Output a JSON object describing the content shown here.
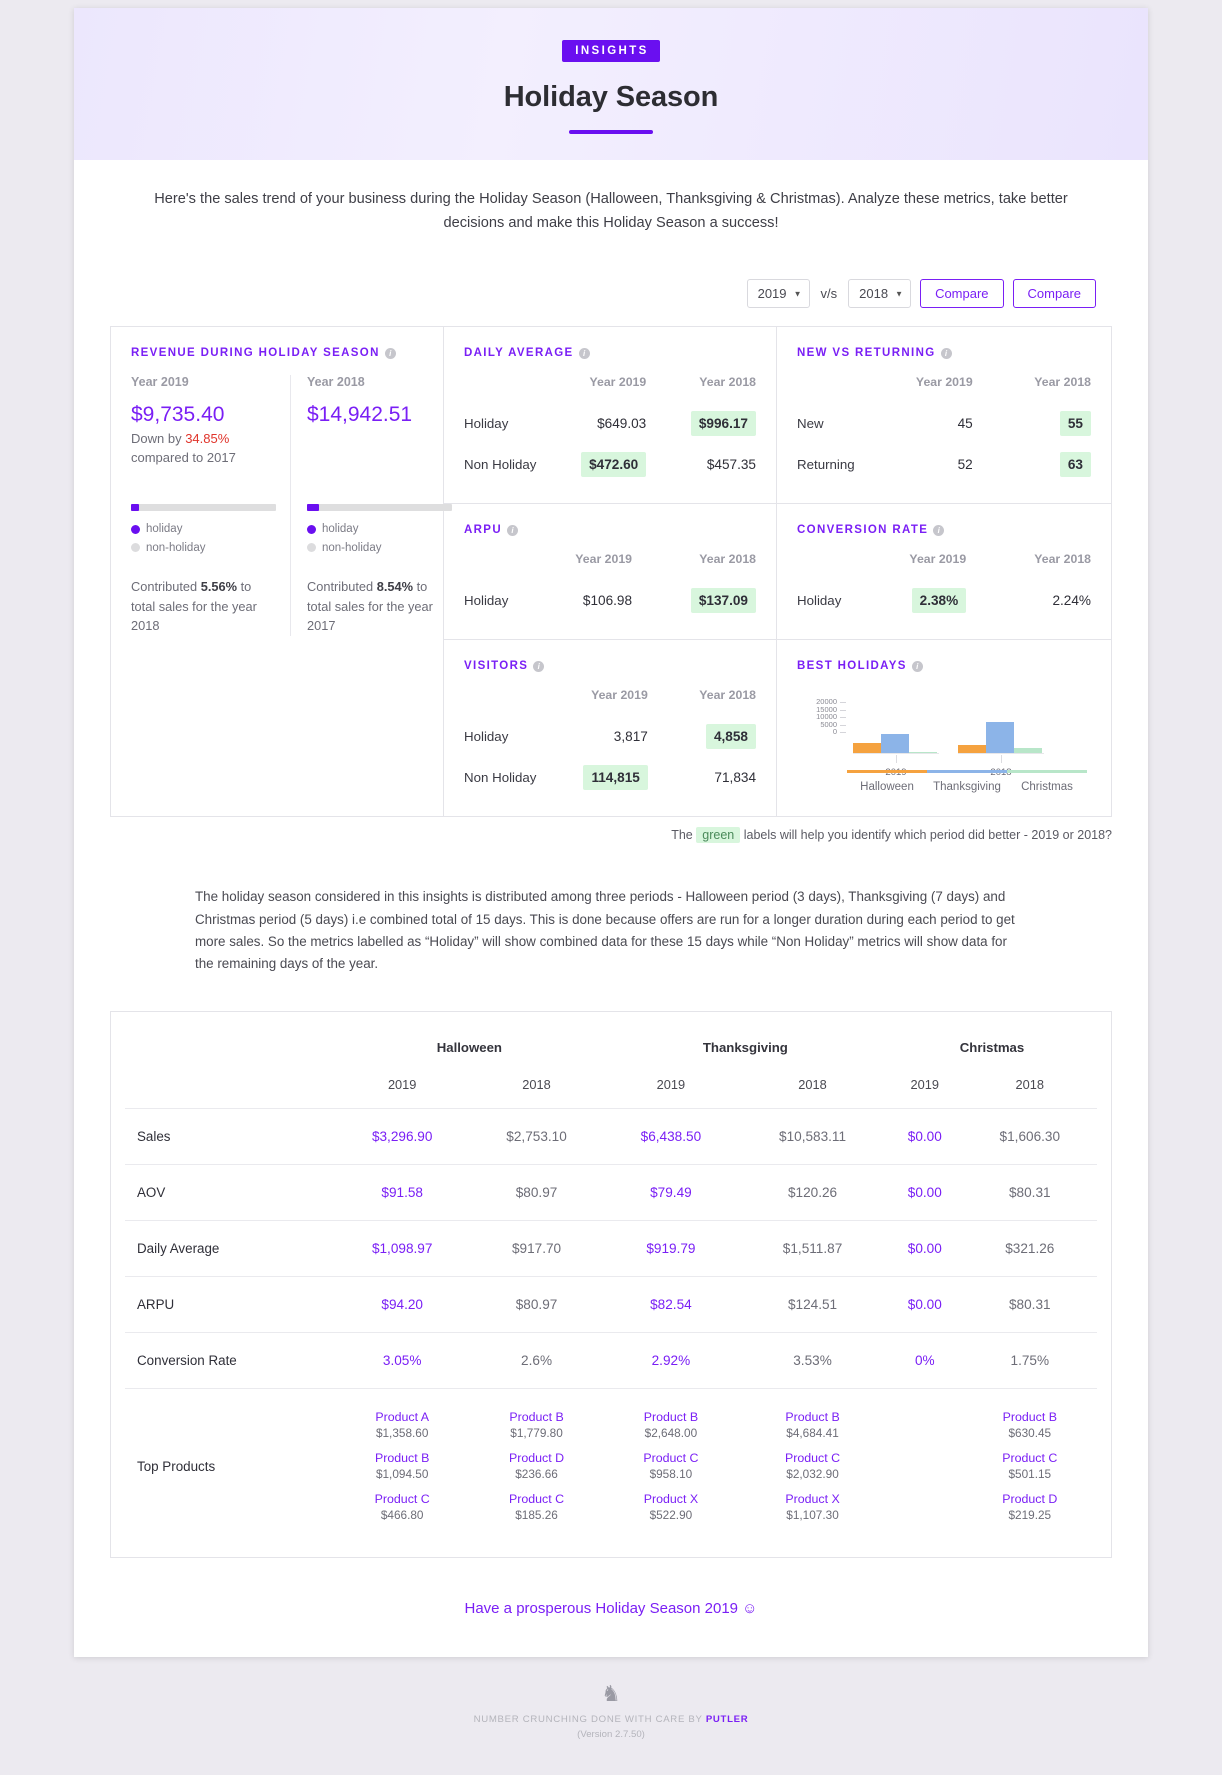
{
  "header": {
    "badge": "INSIGHTS",
    "title": "Holiday Season"
  },
  "intro": "Here's the sales trend of your business during the Holiday Season (Halloween, Thanksgiving & Christmas). Analyze these metrics, take better decisions and make this Holiday Season a success!",
  "controls": {
    "year_primary": "2019",
    "vs_label": "v/s",
    "year_secondary": "2018",
    "compare_label": "Compare",
    "compare_label_2": "Compare",
    "caret": "▼"
  },
  "revenue": {
    "title": "REVENUE DURING HOLIDAY SEASON",
    "left": {
      "year_label": "Year 2019",
      "amount": "$9,735.40",
      "trend_prefix": "Down by",
      "trend_value": "34.85%",
      "trend_suffix": "compared to 2017",
      "bar_percent": 5.56,
      "legend_holiday": "holiday",
      "legend_nonholiday": "non-holiday",
      "contrib_prefix": "Contributed",
      "contrib_value": "5.56%",
      "contrib_suffix": "to total sales for the year 2018"
    },
    "right": {
      "year_label": "Year 2018",
      "amount": "$14,942.51",
      "bar_percent": 8.54,
      "legend_holiday": "holiday",
      "legend_nonholiday": "non-holiday",
      "contrib_prefix": "Contributed",
      "contrib_value": "8.54%",
      "contrib_suffix": "to total sales for the year 2017"
    }
  },
  "daily_average": {
    "title": "DAILY AVERAGE",
    "col_2019": "Year 2019",
    "col_2018": "Year 2018",
    "rows": [
      {
        "label": "Holiday",
        "v2019": "$649.03",
        "v2018": "$996.17",
        "hl": "2018"
      },
      {
        "label": "Non Holiday",
        "v2019": "$472.60",
        "v2018": "$457.35",
        "hl": "2019"
      }
    ]
  },
  "arpu": {
    "title": "ARPU",
    "col_2019": "Year 2019",
    "col_2018": "Year 2018",
    "rows": [
      {
        "label": "Holiday",
        "v2019": "$106.98",
        "v2018": "$137.09",
        "hl": "2018"
      }
    ]
  },
  "visitors": {
    "title": "VISITORS",
    "col_2019": "Year 2019",
    "col_2018": "Year 2018",
    "rows": [
      {
        "label": "Holiday",
        "v2019": "3,817",
        "v2018": "4,858",
        "hl": "2018"
      },
      {
        "label": "Non Holiday",
        "v2019": "114,815",
        "v2018": "71,834",
        "hl": "2019"
      }
    ]
  },
  "new_vs_returning": {
    "title": "NEW VS RETURNING",
    "col_2019": "Year 2019",
    "col_2018": "Year 2018",
    "rows": [
      {
        "label": "New",
        "v2019": "45",
        "v2018": "55",
        "hl": "2018"
      },
      {
        "label": "Returning",
        "v2019": "52",
        "v2018": "63",
        "hl": "2018"
      }
    ]
  },
  "conversion_rate": {
    "title": "CONVERSION RATE",
    "col_2019": "Year 2019",
    "col_2018": "Year 2018",
    "rows": [
      {
        "label": "Holiday",
        "v2019": "2.38%",
        "v2018": "2.24%",
        "hl": "2019"
      }
    ]
  },
  "best_holidays": {
    "title": "BEST HOLIDAYS",
    "group_labels": [
      "2019",
      "2018"
    ],
    "x_labels": [
      "Halloween",
      "Thanksgiving",
      "Christmas"
    ],
    "colors": {
      "halloween": "#f5a23f",
      "thanksgiving": "#8cb4e8",
      "christmas": "#b8e6c9"
    }
  },
  "chart_data": {
    "type": "bar",
    "title": "Best Holidays",
    "xlabel": "",
    "ylabel": "",
    "ylim": [
      0,
      20000
    ],
    "yticks": [
      0,
      5000,
      10000,
      15000,
      20000
    ],
    "ytick_labels": [
      "0",
      "5000",
      "10000",
      "15000",
      "20000"
    ],
    "grid": false,
    "legend_position": "bottom",
    "categories": [
      "2019",
      "2018"
    ],
    "series": [
      {
        "name": "Halloween",
        "color": "#f5a23f",
        "values": [
          3296.9,
          2753.1
        ]
      },
      {
        "name": "Thanksgiving",
        "color": "#8cb4e8",
        "values": [
          6438.5,
          10583.11
        ]
      },
      {
        "name": "Christmas",
        "color": "#b8e6c9",
        "values": [
          0.0,
          1606.3
        ]
      }
    ]
  },
  "green_note": {
    "prefix": "The",
    "green_word": "green",
    "suffix": "labels will help you identify which period did better - 2019 or 2018?"
  },
  "paragraph": "The holiday season considered in this insights is distributed among three periods - Halloween period (3 days), Thanksgiving (7 days) and Christmas period (5 days) i.e combined total of 15 days. This is done because offers are run for a longer duration during each period to get more sales. So the metrics labelled as “Holiday” will show combined data for these 15 days while “Non Holiday” metrics will show data for the remaining days of the year.",
  "breakdown_table": {
    "groups": [
      "Halloween",
      "Thanksgiving",
      "Christmas"
    ],
    "year_headers": [
      "2019",
      "2018",
      "2019",
      "2018",
      "2019",
      "2018"
    ],
    "rows": [
      {
        "label": "Sales",
        "values": [
          "$3,296.90",
          "$2,753.10",
          "$6,438.50",
          "$10,583.11",
          "$0.00",
          "$1,606.30"
        ]
      },
      {
        "label": "AOV",
        "values": [
          "$91.58",
          "$80.97",
          "$79.49",
          "$120.26",
          "$0.00",
          "$80.31"
        ]
      },
      {
        "label": "Daily Average",
        "values": [
          "$1,098.97",
          "$917.70",
          "$919.79",
          "$1,511.87",
          "$0.00",
          "$321.26"
        ]
      },
      {
        "label": "ARPU",
        "values": [
          "$94.20",
          "$80.97",
          "$82.54",
          "$124.51",
          "$0.00",
          "$80.31"
        ]
      },
      {
        "label": "Conversion Rate",
        "values": [
          "3.05%",
          "2.6%",
          "2.92%",
          "3.53%",
          "0%",
          "1.75%"
        ]
      }
    ],
    "top_products_label": "Top Products",
    "top_products": [
      [
        {
          "name": "Product A",
          "value": "$1,358.60"
        },
        {
          "name": "Product B",
          "value": "$1,094.50"
        },
        {
          "name": "Product C",
          "value": "$466.80"
        }
      ],
      [
        {
          "name": "Product B",
          "value": "$1,779.80"
        },
        {
          "name": "Product D",
          "value": "$236.66"
        },
        {
          "name": "Product C",
          "value": "$185.26"
        }
      ],
      [
        {
          "name": "Product B",
          "value": "$2,648.00"
        },
        {
          "name": "Product C",
          "value": "$958.10"
        },
        {
          "name": "Product X",
          "value": "$522.90"
        }
      ],
      [
        {
          "name": "Product B",
          "value": "$4,684.41"
        },
        {
          "name": "Product C",
          "value": "$2,032.90"
        },
        {
          "name": "Product X",
          "value": "$1,107.30"
        }
      ],
      [],
      [
        {
          "name": "Product B",
          "value": "$630.45"
        },
        {
          "name": "Product C",
          "value": "$501.15"
        },
        {
          "name": "Product D",
          "value": "$219.25"
        }
      ]
    ]
  },
  "wish": "Have a prosperous Holiday Season 2019 ☺",
  "footer": {
    "line1_prefix": "NUMBER CRUNCHING DONE WITH CARE BY",
    "brand": "PUTLER",
    "version": "(Version 2.7.50)"
  }
}
